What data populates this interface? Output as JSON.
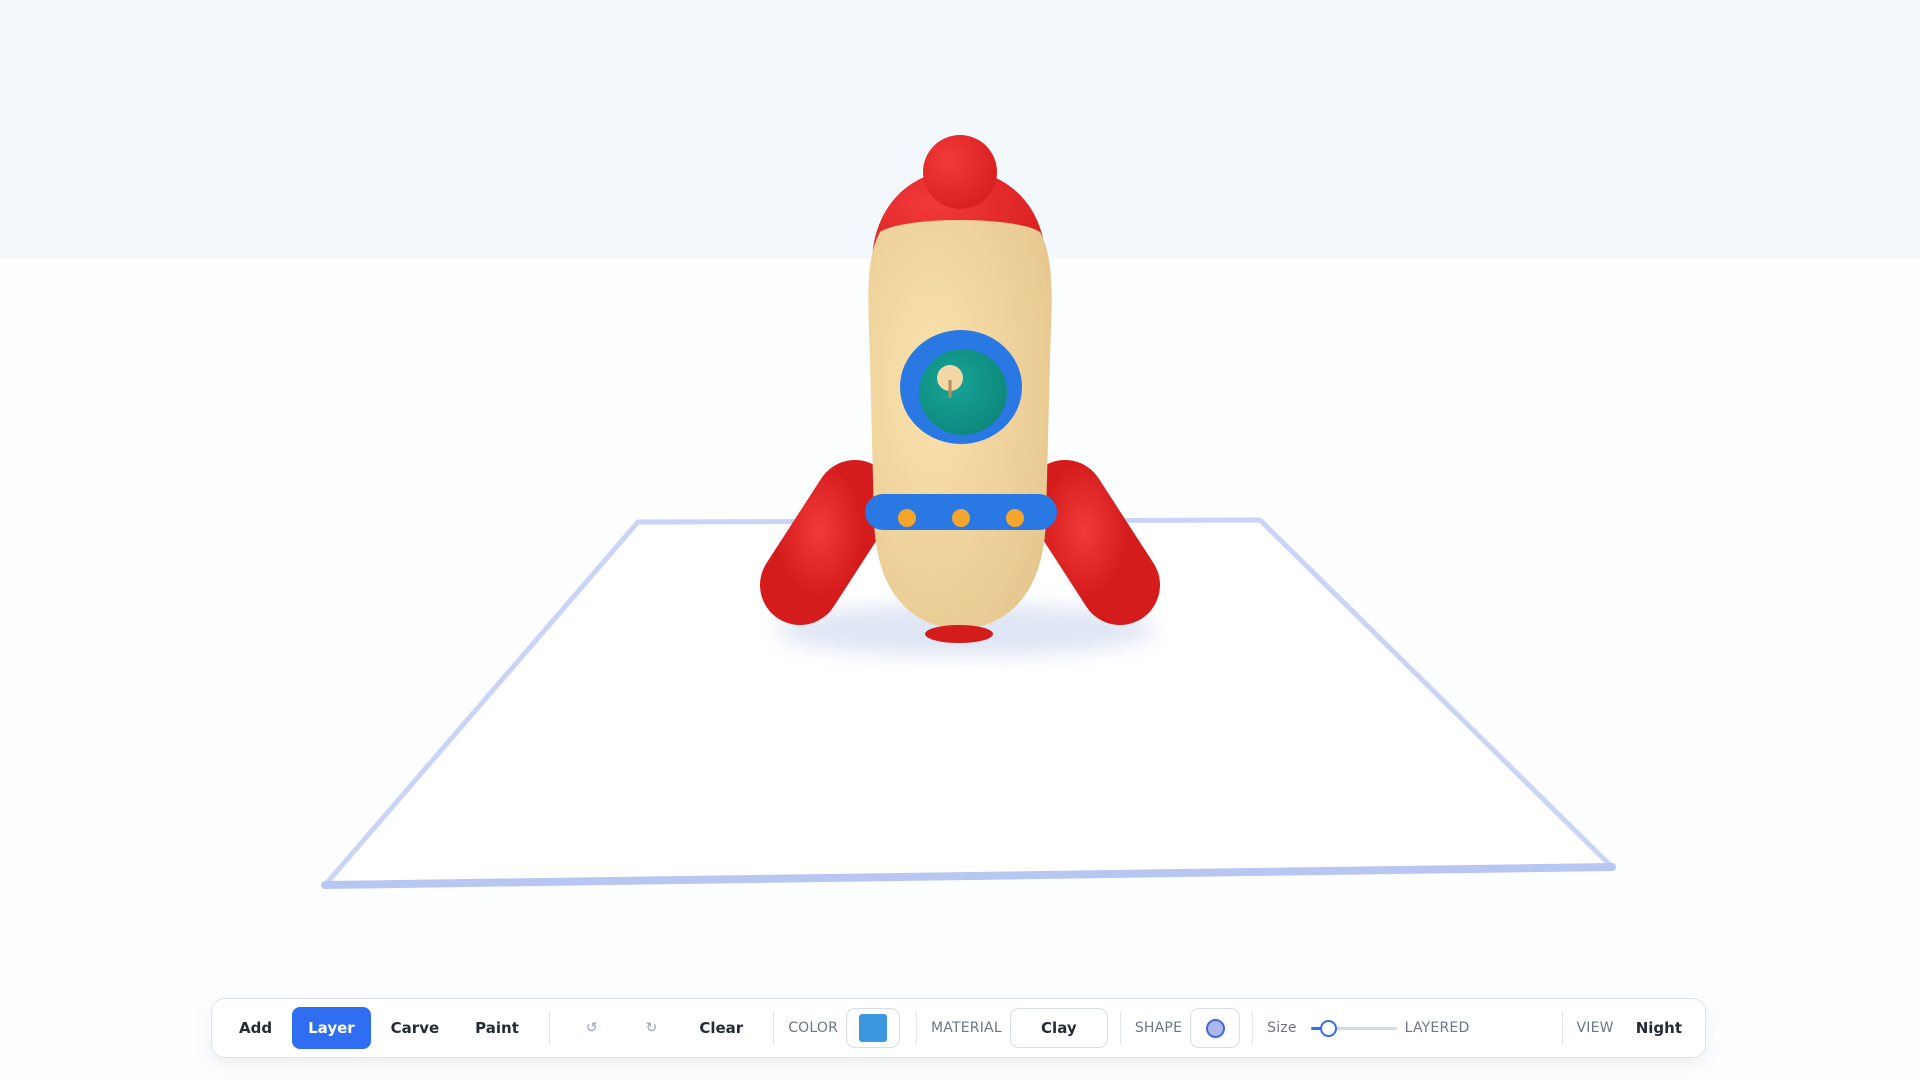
{
  "toolbar": {
    "tools": [
      {
        "label": "Add",
        "active": false
      },
      {
        "label": "Layer",
        "active": true
      },
      {
        "label": "Carve",
        "active": false
      },
      {
        "label": "Paint",
        "active": false
      }
    ],
    "undo_glyph": "↺",
    "redo_glyph": "↻",
    "clear_label": "Clear",
    "color_label": "COLOR",
    "color_value": "#3d97e0",
    "material_label": "MATERIAL",
    "material_value": "Clay",
    "shape_label": "SHAPE",
    "shape_icon": "sphere-icon",
    "size_label": "Size",
    "size_level": 0.2,
    "mode_text": "LAYERED",
    "view_label": "VIEW",
    "view_value": "Night"
  },
  "colors": {
    "accent": "#2f6df2",
    "rocket_red": "#e52a2a",
    "rocket_body": "#f3d8a0",
    "rocket_blue": "#2a78e4",
    "window_teal": "#129b8e",
    "rivet_orange": "#f4a62c",
    "platform_outline": "#c9d4f6"
  }
}
